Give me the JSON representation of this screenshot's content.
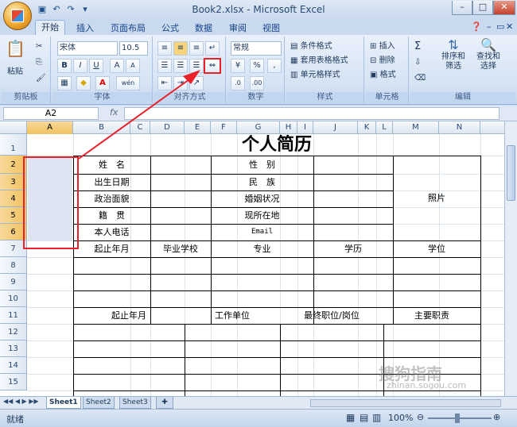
{
  "window": {
    "title": "Book2.xlsx - Microsoft Excel"
  },
  "tabs": [
    "开始",
    "插入",
    "页面布局",
    "公式",
    "数据",
    "审阅",
    "视图"
  ],
  "ribbon": {
    "clipboard": {
      "label": "剪贴板",
      "paste": "粘贴"
    },
    "font": {
      "label": "字体",
      "name": "宋体",
      "size": "10.5",
      "bold": "B",
      "italic": "I",
      "underline": "U",
      "grow": "A",
      "shrink": "A",
      "wen": "wén"
    },
    "alignment": {
      "label": "对齐方式"
    },
    "number": {
      "label": "数字",
      "format": "常规",
      "pct": "%",
      "comma": ","
    },
    "styles": {
      "label": "样式",
      "cond": "条件格式",
      "table": "套用表格格式",
      "cell": "单元格样式"
    },
    "cells": {
      "label": "单元格",
      "insert": "插入",
      "delete": "删除",
      "format": "格式"
    },
    "editing": {
      "label": "编辑",
      "sigma": "Σ",
      "sort": "排序和\n筛选",
      "find": "查找和\n选择"
    }
  },
  "formula_bar": {
    "name_box": "A2",
    "fx": "fx",
    "value": ""
  },
  "columns": [
    "A",
    "B",
    "C",
    "D",
    "E",
    "F",
    "G",
    "H",
    "I",
    "J",
    "K",
    "L",
    "M",
    "N"
  ],
  "rows": [
    "1",
    "2",
    "3",
    "4",
    "5",
    "6",
    "7",
    "8",
    "9",
    "10",
    "11",
    "12",
    "13",
    "14",
    "15"
  ],
  "sheet": {
    "title": "个人简历",
    "r2": [
      "姓　名",
      "性　别"
    ],
    "r3": [
      "出生日期",
      "民　族"
    ],
    "r4": [
      "政治面貌",
      "婚姻状况"
    ],
    "r5": [
      "籍　贯",
      "现所在地"
    ],
    "r6": [
      "本人电话",
      "Email"
    ],
    "photo": "照片",
    "r7": [
      "起止年月",
      "毕业学校",
      "专业",
      "学历",
      "学位"
    ],
    "r11": [
      "起止年月",
      "工作单位",
      "最终职位/岗位",
      "主要职责"
    ]
  },
  "sheet_tabs": [
    "Sheet1",
    "Sheet2",
    "Sheet3"
  ],
  "status": {
    "ready": "就绪",
    "zoom": "100%"
  },
  "watermark": {
    "brand": "搜狗指南",
    "url": "zhinan.sogou.com"
  }
}
